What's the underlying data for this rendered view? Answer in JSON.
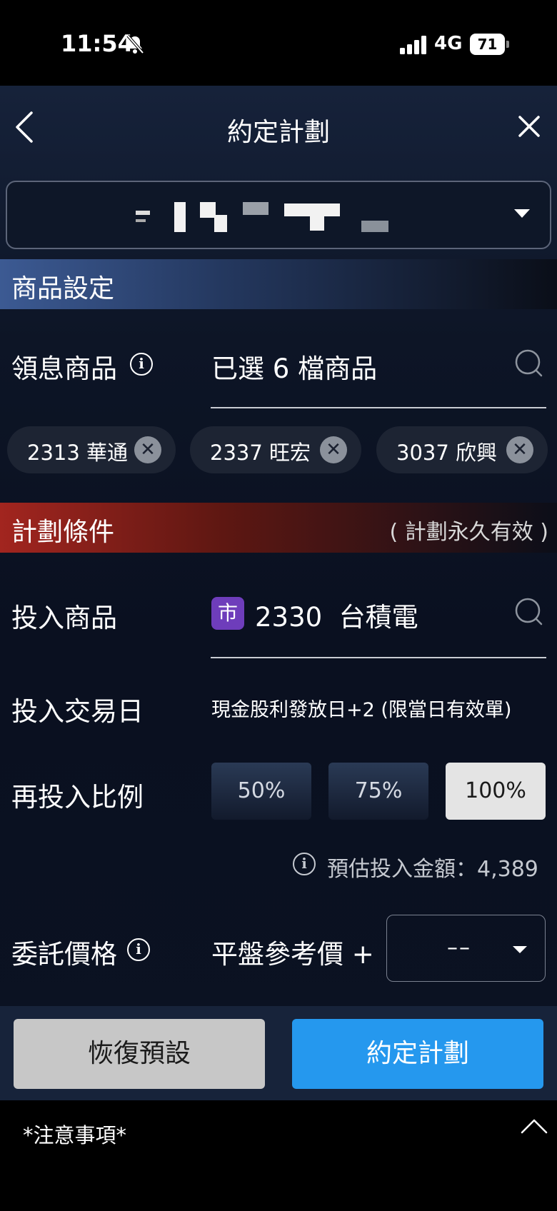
{
  "status_bar": {
    "time": "11:54",
    "network": "4G",
    "battery": "71"
  },
  "nav": {
    "title": "約定計劃"
  },
  "section_product": {
    "title": "商品設定",
    "dividend_label": "領息商品",
    "selected_text": "已選 6 檔商品",
    "chips": [
      "2313 華通",
      "2337 旺宏",
      "3037 欣興"
    ]
  },
  "section_plan": {
    "title": "計劃條件",
    "note": "( 計劃永久有效 )",
    "invest_label": "投入商品",
    "invest_badge": "市",
    "invest_value": "2330  台積電",
    "trade_day_label": "投入交易日",
    "trade_day_value": "現金股利發放日+2 (限當日有效單)",
    "ratio_label": "再投入比例",
    "ratios": [
      "50%",
      "75%",
      "100%"
    ],
    "selected_ratio": "100%",
    "estimate_text": "預估投入金額：4,389",
    "price_label": "委託價格",
    "price_base": "平盤參考價 +",
    "price_select_value": "––"
  },
  "actions": {
    "reset": "恢復預設",
    "submit": "約定計劃"
  },
  "footer": {
    "notes": "*注意事項*"
  }
}
